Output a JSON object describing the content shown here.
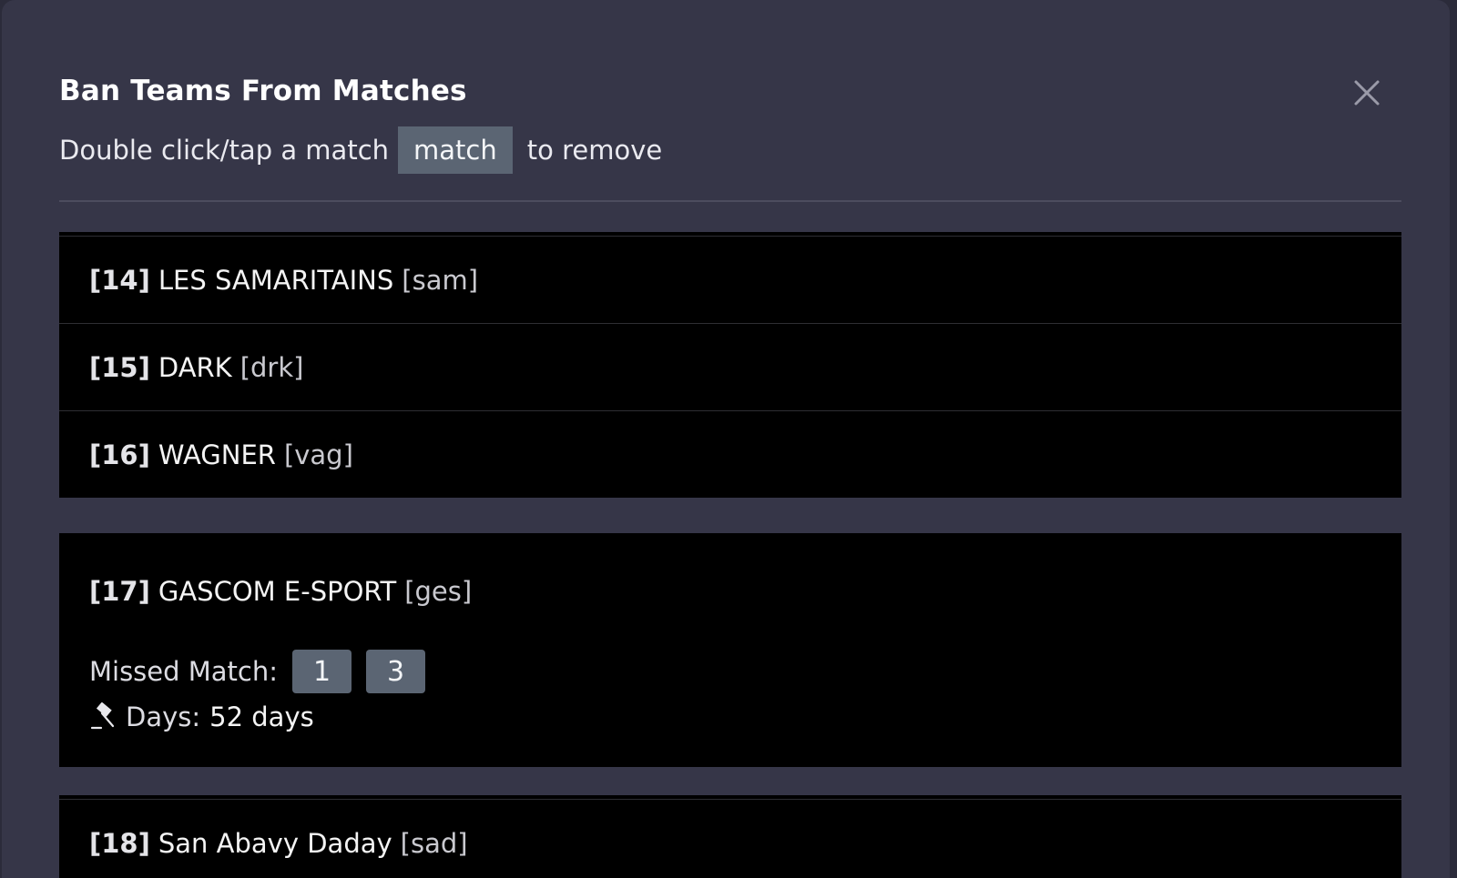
{
  "modal": {
    "title": "Ban Teams From Matches",
    "subtitle_prefix": "Double click/tap a match",
    "subtitle_chip": "match",
    "subtitle_suffix": "to remove"
  },
  "teams": [
    {
      "seed": "[14]",
      "name": "LES SAMARITAINS",
      "tag": "[sam]"
    },
    {
      "seed": "[15]",
      "name": "DARK",
      "tag": "[drk]"
    },
    {
      "seed": "[16]",
      "name": "WAGNER",
      "tag": "[vag]"
    },
    {
      "seed": "[17]",
      "name": "GASCOM E-SPORT",
      "tag": "[ges]",
      "missed_label": "Missed Match:",
      "missed_matches": [
        "1",
        "3"
      ],
      "days_label": "Days:",
      "days_value": "52 days"
    },
    {
      "seed": "[18]",
      "name": "San Abavy Daday",
      "tag": "[sad]"
    }
  ],
  "icons": {
    "close": "close-icon",
    "days": "gavel-icon"
  },
  "colors": {
    "modal_bg": "#363648",
    "row_bg": "#000000",
    "chip_bg": "#5b6573",
    "divider": "#4c4c5e"
  }
}
